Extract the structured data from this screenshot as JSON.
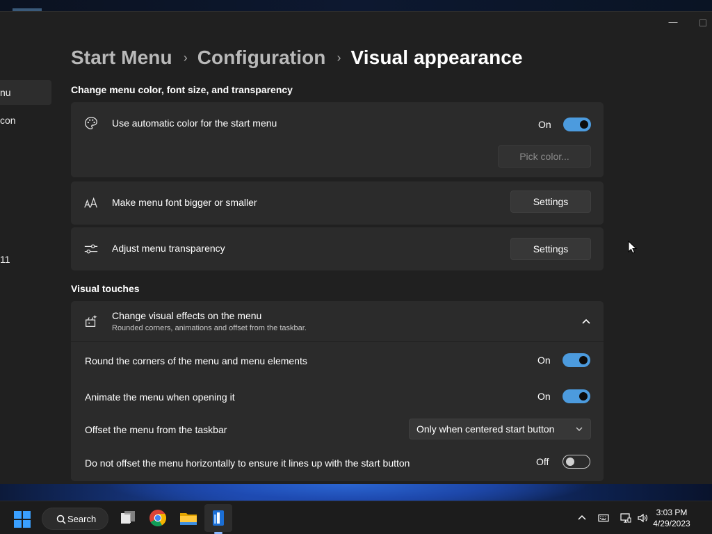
{
  "nav": {
    "items": [
      {
        "label": "nu",
        "selected": true
      },
      {
        "label": "con",
        "selected": false
      },
      {
        "label": "11",
        "selected": false
      }
    ]
  },
  "breadcrumb": {
    "items": [
      "Start Menu",
      "Configuration",
      "Visual appearance"
    ]
  },
  "section1": {
    "title": "Change menu color, font size, and transparency",
    "auto_color": {
      "label": "Use automatic color for the start menu",
      "state": "On",
      "pick_color": "Pick color..."
    },
    "font_size": {
      "label": "Make menu font bigger or smaller",
      "button": "Settings"
    },
    "transparency": {
      "label": "Adjust menu transparency",
      "button": "Settings"
    }
  },
  "section2": {
    "title": "Visual touches",
    "effects": {
      "label": "Change visual effects on the menu",
      "sublabel": "Rounded corners, animations and offset from the taskbar.",
      "rows": {
        "round": {
          "label": "Round the corners of the menu and menu elements",
          "state": "On"
        },
        "animate": {
          "label": "Animate the menu when opening it",
          "state": "On"
        },
        "offset": {
          "label": "Offset the menu from the taskbar",
          "value": "Only when centered start button"
        },
        "no_offset": {
          "label": "Do not offset the menu horizontally to ensure it lines up with the start button",
          "state": "Off"
        }
      }
    }
  },
  "taskbar": {
    "search": "Search",
    "time": "3:03 PM",
    "date": "4/29/2023"
  },
  "colors": {
    "accent": "#4c9bde",
    "background": "#202020",
    "card": "#2b2b2b"
  }
}
